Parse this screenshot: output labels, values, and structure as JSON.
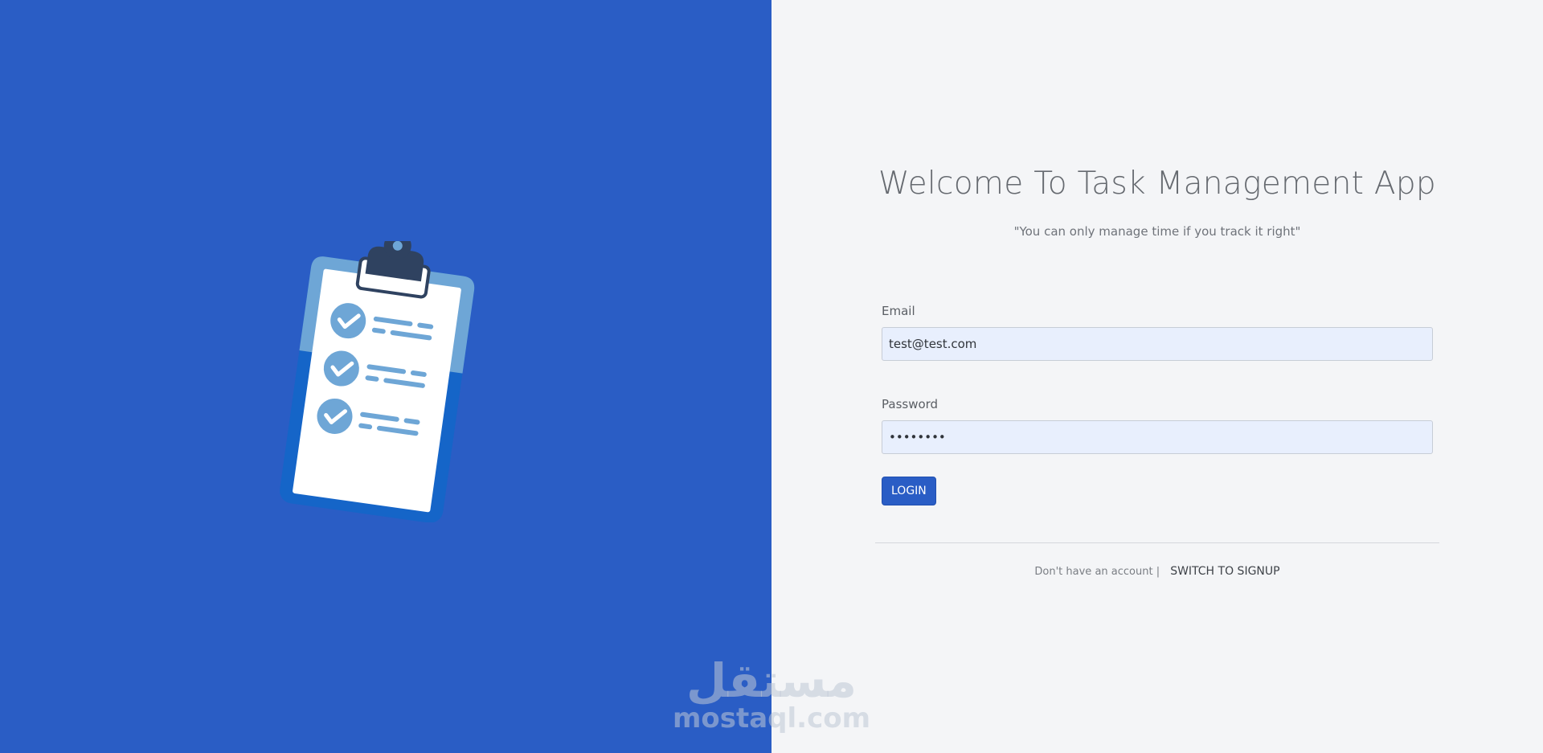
{
  "colors": {
    "brand_blue": "#2a5dc5",
    "panel_background": "#f4f5f7",
    "input_background": "#e8effd",
    "clipboard_light_blue": "#6ea6d6",
    "clipboard_dark": "#2f4260"
  },
  "hero": {
    "illustration": "clipboard-checklist-icon"
  },
  "header": {
    "title": "Welcome To Task Management App",
    "subtitle": "\"You can only manage time if you track it right\""
  },
  "form": {
    "email": {
      "label": "Email",
      "value": "test@test.com"
    },
    "password": {
      "label": "Password",
      "value": "••••••••"
    },
    "login_label": "LOGIN"
  },
  "footer": {
    "prompt": "Don't have an account |",
    "switch_label": "SWITCH TO SIGNUP"
  },
  "watermark": {
    "arabic": "مستقل",
    "latin": "mostaql.com"
  }
}
